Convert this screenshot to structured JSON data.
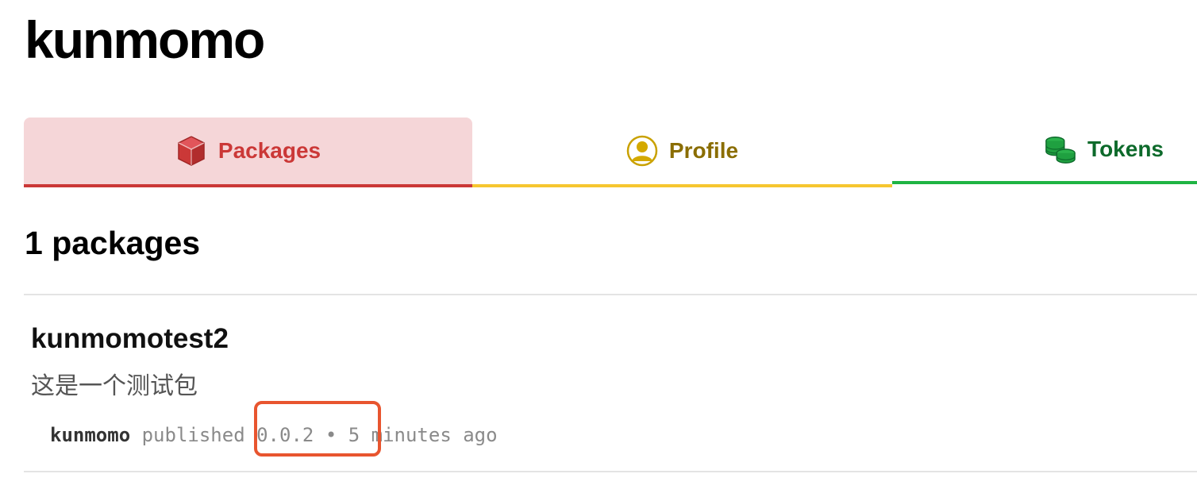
{
  "user": {
    "username": "kunmomo"
  },
  "tabs": [
    {
      "label": "Packages",
      "icon": "package-icon",
      "color": "#cb3837"
    },
    {
      "label": "Profile",
      "icon": "user-circle-icon",
      "color": "#8a6d00"
    },
    {
      "label": "Tokens",
      "icon": "coins-icon",
      "color": "#0d6a2b"
    }
  ],
  "packages_section": {
    "count_heading": "1 packages",
    "items": [
      {
        "name": "kunmomotest2",
        "description": "这是一个测试包",
        "publisher": "kunmomo",
        "published_word": "published",
        "version": "0.0.2",
        "separator": "•",
        "time_ago": "5 minutes ago"
      }
    ]
  },
  "colors": {
    "packages_accent": "#cb3837",
    "profile_accent": "#f6c630",
    "tokens_accent": "#1fb443",
    "highlight": "#e8552f"
  }
}
